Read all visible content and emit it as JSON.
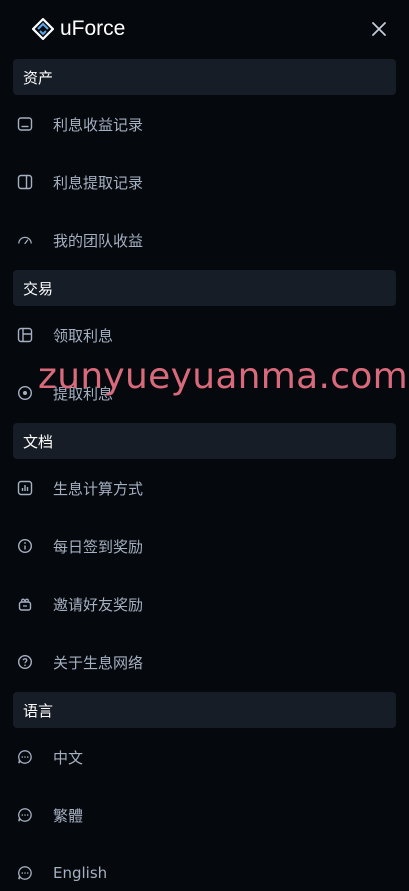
{
  "header": {
    "brand": "uForce",
    "logo_icon": "diamond-logo-icon",
    "close_icon": "close-icon"
  },
  "sections": [
    {
      "title": "资产",
      "items": [
        {
          "label": "利息收益记录",
          "icon": "wallet-icon"
        },
        {
          "label": "利息提取记录",
          "icon": "sidebar-panel-icon"
        },
        {
          "label": "我的团队收益",
          "icon": "gauge-icon"
        }
      ]
    },
    {
      "title": "交易",
      "items": [
        {
          "label": "领取利息",
          "icon": "layout-icon"
        },
        {
          "label": "提取利息",
          "icon": "target-icon"
        }
      ]
    },
    {
      "title": "文档",
      "items": [
        {
          "label": "生息计算方式",
          "icon": "bar-chart-icon"
        },
        {
          "label": "每日签到奖励",
          "icon": "info-icon"
        },
        {
          "label": "邀请好友奖励",
          "icon": "gift-icon"
        },
        {
          "label": "关于生息网络",
          "icon": "help-icon"
        }
      ]
    },
    {
      "title": "语言",
      "items": [
        {
          "label": "中文",
          "icon": "chat-icon"
        },
        {
          "label": "繁體",
          "icon": "chat-icon"
        },
        {
          "label": "English",
          "icon": "chat-icon"
        }
      ]
    }
  ],
  "watermark": "zunyueyuanma.com",
  "colors": {
    "background": "#05080d",
    "section_bg": "#171d26",
    "text": "#a5b0c1",
    "watermark": "#d96a7c",
    "logo_accent": "#5aa3e6"
  }
}
